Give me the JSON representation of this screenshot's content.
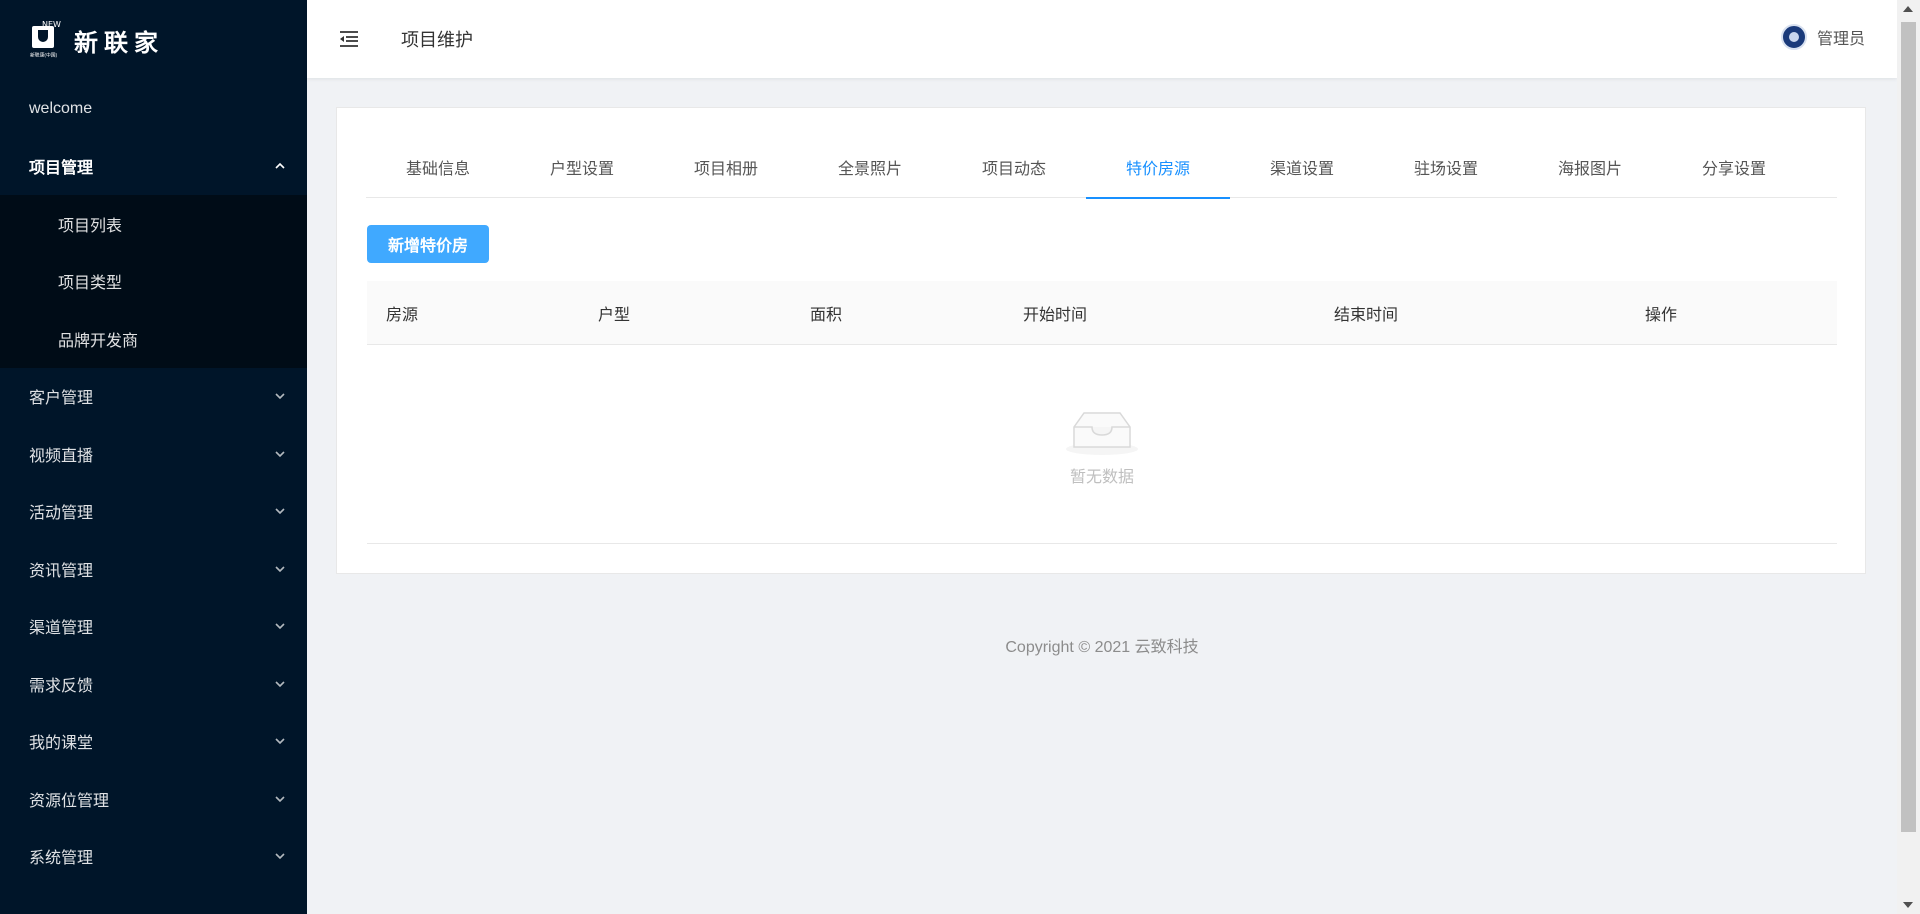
{
  "brand": {
    "name": "新联家",
    "mark_top": "NEW",
    "mark_sub": "新联康(中国)"
  },
  "sidebar": {
    "items": [
      {
        "label": "welcome"
      },
      {
        "label": "项目管理",
        "expanded": true,
        "children": [
          {
            "label": "项目列表"
          },
          {
            "label": "项目类型"
          },
          {
            "label": "品牌开发商"
          }
        ]
      },
      {
        "label": "客户管理"
      },
      {
        "label": "视频直播"
      },
      {
        "label": "活动管理"
      },
      {
        "label": "资讯管理"
      },
      {
        "label": "渠道管理"
      },
      {
        "label": "需求反馈"
      },
      {
        "label": "我的课堂"
      },
      {
        "label": "资源位管理"
      },
      {
        "label": "系统管理"
      }
    ]
  },
  "header": {
    "title": "项目维护",
    "user_name": "管理员"
  },
  "tabs": [
    {
      "label": "基础信息"
    },
    {
      "label": "户型设置"
    },
    {
      "label": "项目相册"
    },
    {
      "label": "全景照片"
    },
    {
      "label": "项目动态"
    },
    {
      "label": "特价房源",
      "active": true
    },
    {
      "label": "渠道设置"
    },
    {
      "label": "驻场设置"
    },
    {
      "label": "海报图片"
    },
    {
      "label": "分享设置"
    }
  ],
  "toolbar": {
    "add_label": "新增特价房"
  },
  "table": {
    "columns": [
      "房源",
      "户型",
      "面积",
      "开始时间",
      "结束时间",
      "操作"
    ],
    "rows": [],
    "empty_text": "暂无数据"
  },
  "footer": {
    "copyright": "Copyright",
    "text": "2021 云致科技"
  },
  "colors": {
    "sidebar_bg": "#001529",
    "submenu_bg": "#000c17",
    "accent": "#1890ff",
    "button": "#40a9ff"
  }
}
